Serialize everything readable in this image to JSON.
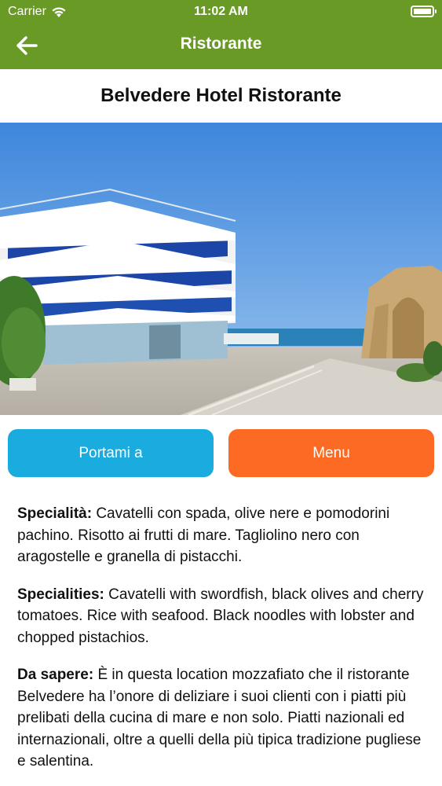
{
  "status_bar": {
    "carrier": "Carrier",
    "time": "11:02 AM",
    "battery_level": 1.0
  },
  "nav": {
    "title": "Ristorante",
    "back_icon": "arrow-left-icon"
  },
  "restaurant": {
    "name": "Belvedere Hotel Ristorante"
  },
  "actions": {
    "directions_label": "Portami a",
    "menu_label": "Menu"
  },
  "colors": {
    "header_green": "#6a9a26",
    "directions_blue": "#1aabdf",
    "menu_orange": "#fc6a24"
  },
  "description": {
    "specialita_label": "Specialità:",
    "specialita_text": " Cavatelli con spada, olive nere e pomodorini pachino. Risotto ai frutti di mare. Tagliolino nero con aragostelle e granella di pistacchi.",
    "specialities_label": "Specialities:",
    "specialities_text": " Cavatelli with swordfish, black olives and cherry tomatoes. Rice with seafood. Black noodles with lobster and chopped pistachios.",
    "da_sapere_label": "Da sapere:",
    "da_sapere_text": " È in questa location mozzafiato che il ristorante Belvedere ha l’onore di deliziare i suoi clienti con i piatti più prelibati della cucina di mare e non solo. Piatti nazionali ed internazionali, oltre a quelli della più tipica tradizione pugliese e salentina."
  }
}
